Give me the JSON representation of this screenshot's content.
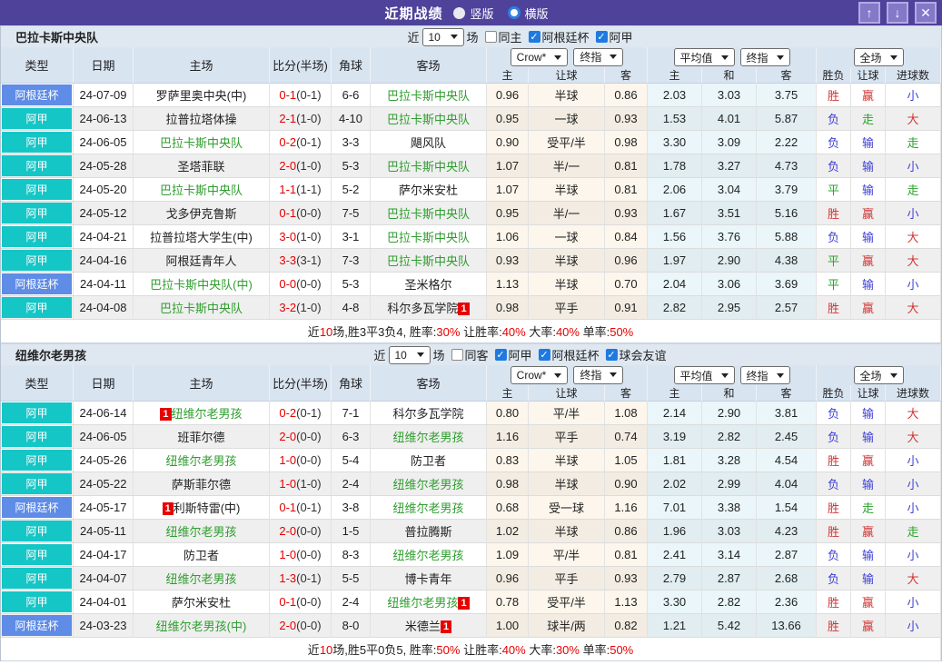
{
  "colors": {
    "titlebar_bg": "#4e429b",
    "cup_badge": "#5e8ce6",
    "league_badge": "#15c6c6",
    "focal_green": "#2f9e2f",
    "score_red": "#e60000",
    "win_red": "#d23535",
    "lose_blue": "#3e3ed6",
    "draw_green": "#2ba32b",
    "note_red": "#e60000",
    "checkbox_blue": "#1e7ae0"
  },
  "icons": {
    "check": "✓"
  },
  "titlebar": {
    "title": "近期战绩",
    "radios": [
      {
        "label": "竖版",
        "selected": true
      },
      {
        "label": "横版",
        "selected": false
      }
    ],
    "buttons": [
      {
        "name": "up",
        "glyph": "↑"
      },
      {
        "name": "down",
        "glyph": "↓"
      },
      {
        "name": "close",
        "glyph": "✕"
      }
    ]
  },
  "table_headers": {
    "left_cols": [
      "类型",
      "日期",
      "主场",
      "比分(半场)",
      "角球",
      "客场"
    ],
    "group1": [
      "Crow*",
      "终指"
    ],
    "group2": [
      "平均值",
      "终指"
    ],
    "group3": [
      "全场"
    ],
    "sub": [
      "主",
      "让球",
      "客",
      "主",
      "和",
      "客",
      "胜负",
      "让球",
      "进球数"
    ]
  },
  "sections": [
    {
      "team": "巴拉卡斯中央队",
      "filter": {
        "prefix": "近",
        "count": "10",
        "suffix": "场",
        "extra": {
          "label": "同主",
          "checked": false
        },
        "leagues": [
          {
            "label": "阿根廷杯",
            "checked": true
          },
          {
            "label": "阿甲",
            "checked": true
          }
        ]
      },
      "rows": [
        {
          "type": "阿根廷杯",
          "cup": true,
          "date": "24-07-09",
          "home": {
            "name": "罗萨里奥中央(中)",
            "focal": false
          },
          "score": "0-1",
          "half": "(0-1)",
          "corner": "6-6",
          "away": {
            "name": "巴拉卡斯中央队",
            "focal": true
          },
          "crow": [
            "0.96",
            "半球",
            "0.86"
          ],
          "avg": [
            "2.03",
            "3.03",
            "3.75"
          ],
          "res": [
            [
              "胜",
              "red"
            ],
            [
              "赢",
              "red"
            ],
            [
              "小",
              "blue"
            ]
          ]
        },
        {
          "type": "阿甲",
          "cup": false,
          "date": "24-06-13",
          "home": {
            "name": "拉普拉塔体操",
            "focal": false
          },
          "score": "2-1",
          "half": "(1-0)",
          "corner": "4-10",
          "away": {
            "name": "巴拉卡斯中央队",
            "focal": true
          },
          "crow": [
            "0.95",
            "一球",
            "0.93"
          ],
          "avg": [
            "1.53",
            "4.01",
            "5.87"
          ],
          "res": [
            [
              "负",
              "blue"
            ],
            [
              "走",
              "green"
            ],
            [
              "大",
              "red"
            ]
          ]
        },
        {
          "type": "阿甲",
          "cup": false,
          "date": "24-06-05",
          "home": {
            "name": "巴拉卡斯中央队",
            "focal": true
          },
          "score": "0-2",
          "half": "(0-1)",
          "corner": "3-3",
          "away": {
            "name": "飓风队",
            "focal": false
          },
          "crow": [
            "0.90",
            "受平/半",
            "0.98"
          ],
          "avg": [
            "3.30",
            "3.09",
            "2.22"
          ],
          "res": [
            [
              "负",
              "blue"
            ],
            [
              "输",
              "blue"
            ],
            [
              "走",
              "green"
            ]
          ]
        },
        {
          "type": "阿甲",
          "cup": false,
          "date": "24-05-28",
          "home": {
            "name": "圣塔菲联",
            "focal": false
          },
          "score": "2-0",
          "half": "(1-0)",
          "corner": "5-3",
          "away": {
            "name": "巴拉卡斯中央队",
            "focal": true
          },
          "crow": [
            "1.07",
            "半/一",
            "0.81"
          ],
          "avg": [
            "1.78",
            "3.27",
            "4.73"
          ],
          "res": [
            [
              "负",
              "blue"
            ],
            [
              "输",
              "blue"
            ],
            [
              "小",
              "blue"
            ]
          ]
        },
        {
          "type": "阿甲",
          "cup": false,
          "date": "24-05-20",
          "home": {
            "name": "巴拉卡斯中央队",
            "focal": true
          },
          "score": "1-1",
          "half": "(1-1)",
          "corner": "5-2",
          "away": {
            "name": "萨尔米安杜",
            "focal": false
          },
          "crow": [
            "1.07",
            "半球",
            "0.81"
          ],
          "avg": [
            "2.06",
            "3.04",
            "3.79"
          ],
          "res": [
            [
              "平",
              "green"
            ],
            [
              "输",
              "blue"
            ],
            [
              "走",
              "green"
            ]
          ]
        },
        {
          "type": "阿甲",
          "cup": false,
          "date": "24-05-12",
          "home": {
            "name": "戈多伊克鲁斯",
            "focal": false
          },
          "score": "0-1",
          "half": "(0-0)",
          "corner": "7-5",
          "away": {
            "name": "巴拉卡斯中央队",
            "focal": true
          },
          "crow": [
            "0.95",
            "半/一",
            "0.93"
          ],
          "avg": [
            "1.67",
            "3.51",
            "5.16"
          ],
          "res": [
            [
              "胜",
              "red"
            ],
            [
              "赢",
              "red"
            ],
            [
              "小",
              "blue"
            ]
          ]
        },
        {
          "type": "阿甲",
          "cup": false,
          "date": "24-04-21",
          "home": {
            "name": "拉普拉塔大学生(中)",
            "focal": false
          },
          "score": "3-0",
          "half": "(1-0)",
          "corner": "3-1",
          "away": {
            "name": "巴拉卡斯中央队",
            "focal": true
          },
          "crow": [
            "1.06",
            "一球",
            "0.84"
          ],
          "avg": [
            "1.56",
            "3.76",
            "5.88"
          ],
          "res": [
            [
              "负",
              "blue"
            ],
            [
              "输",
              "blue"
            ],
            [
              "大",
              "red"
            ]
          ]
        },
        {
          "type": "阿甲",
          "cup": false,
          "date": "24-04-16",
          "home": {
            "name": "阿根廷青年人",
            "focal": false
          },
          "score": "3-3",
          "half": "(3-1)",
          "corner": "7-3",
          "away": {
            "name": "巴拉卡斯中央队",
            "focal": true
          },
          "crow": [
            "0.93",
            "半球",
            "0.96"
          ],
          "avg": [
            "1.97",
            "2.90",
            "4.38"
          ],
          "res": [
            [
              "平",
              "green"
            ],
            [
              "赢",
              "red"
            ],
            [
              "大",
              "red"
            ]
          ]
        },
        {
          "type": "阿根廷杯",
          "cup": true,
          "date": "24-04-11",
          "home": {
            "name": "巴拉卡斯中央队(中)",
            "focal": true
          },
          "score": "0-0",
          "half": "(0-0)",
          "corner": "5-3",
          "away": {
            "name": "圣米格尔",
            "focal": false
          },
          "crow": [
            "1.13",
            "半球",
            "0.70"
          ],
          "avg": [
            "2.04",
            "3.06",
            "3.69"
          ],
          "res": [
            [
              "平",
              "green"
            ],
            [
              "输",
              "blue"
            ],
            [
              "小",
              "blue"
            ]
          ]
        },
        {
          "type": "阿甲",
          "cup": false,
          "date": "24-04-08",
          "home": {
            "name": "巴拉卡斯中央队",
            "focal": true
          },
          "score": "3-2",
          "half": "(1-0)",
          "corner": "4-8",
          "away": {
            "name": "科尔多瓦学院",
            "focal": false,
            "badge_after": "1"
          },
          "crow": [
            "0.98",
            "平手",
            "0.91"
          ],
          "avg": [
            "2.82",
            "2.95",
            "2.57"
          ],
          "res": [
            [
              "胜",
              "red"
            ],
            [
              "赢",
              "red"
            ],
            [
              "大",
              "red"
            ]
          ]
        }
      ],
      "summary": [
        {
          "t": "近",
          "c": "k"
        },
        {
          "t": "10",
          "c": "r"
        },
        {
          "t": "场,胜3平3负4, 胜率:",
          "c": "k"
        },
        {
          "t": "30%",
          "c": "r"
        },
        {
          "t": " 让胜率:",
          "c": "k"
        },
        {
          "t": "40%",
          "c": "r"
        },
        {
          "t": " 大率:",
          "c": "k"
        },
        {
          "t": "40%",
          "c": "r"
        },
        {
          "t": " 单率:",
          "c": "k"
        },
        {
          "t": "50%",
          "c": "r"
        }
      ]
    },
    {
      "team": "纽维尔老男孩",
      "filter": {
        "prefix": "近",
        "count": "10",
        "suffix": "场",
        "extra": {
          "label": "同客",
          "checked": false
        },
        "leagues": [
          {
            "label": "阿甲",
            "checked": true
          },
          {
            "label": "阿根廷杯",
            "checked": true
          },
          {
            "label": "球会友谊",
            "checked": true
          }
        ]
      },
      "rows": [
        {
          "type": "阿甲",
          "cup": false,
          "date": "24-06-14",
          "home": {
            "name": "纽维尔老男孩",
            "focal": true,
            "badge_before": "1"
          },
          "score": "0-2",
          "half": "(0-1)",
          "corner": "7-1",
          "away": {
            "name": "科尔多瓦学院",
            "focal": false
          },
          "crow": [
            "0.80",
            "平/半",
            "1.08"
          ],
          "avg": [
            "2.14",
            "2.90",
            "3.81"
          ],
          "res": [
            [
              "负",
              "blue"
            ],
            [
              "输",
              "blue"
            ],
            [
              "大",
              "red"
            ]
          ]
        },
        {
          "type": "阿甲",
          "cup": false,
          "date": "24-06-05",
          "home": {
            "name": "班菲尔德",
            "focal": false
          },
          "score": "2-0",
          "half": "(0-0)",
          "corner": "6-3",
          "away": {
            "name": "纽维尔老男孩",
            "focal": true
          },
          "crow": [
            "1.16",
            "平手",
            "0.74"
          ],
          "avg": [
            "3.19",
            "2.82",
            "2.45"
          ],
          "res": [
            [
              "负",
              "blue"
            ],
            [
              "输",
              "blue"
            ],
            [
              "大",
              "red"
            ]
          ]
        },
        {
          "type": "阿甲",
          "cup": false,
          "date": "24-05-26",
          "home": {
            "name": "纽维尔老男孩",
            "focal": true
          },
          "score": "1-0",
          "half": "(0-0)",
          "corner": "5-4",
          "away": {
            "name": "防卫者",
            "focal": false
          },
          "crow": [
            "0.83",
            "半球",
            "1.05"
          ],
          "avg": [
            "1.81",
            "3.28",
            "4.54"
          ],
          "res": [
            [
              "胜",
              "red"
            ],
            [
              "赢",
              "red"
            ],
            [
              "小",
              "blue"
            ]
          ]
        },
        {
          "type": "阿甲",
          "cup": false,
          "date": "24-05-22",
          "home": {
            "name": "萨斯菲尔德",
            "focal": false
          },
          "score": "1-0",
          "half": "(1-0)",
          "corner": "2-4",
          "away": {
            "name": "纽维尔老男孩",
            "focal": true
          },
          "crow": [
            "0.98",
            "半球",
            "0.90"
          ],
          "avg": [
            "2.02",
            "2.99",
            "4.04"
          ],
          "res": [
            [
              "负",
              "blue"
            ],
            [
              "输",
              "blue"
            ],
            [
              "小",
              "blue"
            ]
          ]
        },
        {
          "type": "阿根廷杯",
          "cup": true,
          "date": "24-05-17",
          "home": {
            "name": "利斯特雷(中)",
            "focal": false,
            "badge_before": "1"
          },
          "score": "0-1",
          "half": "(0-1)",
          "corner": "3-8",
          "away": {
            "name": "纽维尔老男孩",
            "focal": true
          },
          "crow": [
            "0.68",
            "受一球",
            "1.16"
          ],
          "avg": [
            "7.01",
            "3.38",
            "1.54"
          ],
          "res": [
            [
              "胜",
              "red"
            ],
            [
              "走",
              "green"
            ],
            [
              "小",
              "blue"
            ]
          ]
        },
        {
          "type": "阿甲",
          "cup": false,
          "date": "24-05-11",
          "home": {
            "name": "纽维尔老男孩",
            "focal": true
          },
          "score": "2-0",
          "half": "(0-0)",
          "corner": "1-5",
          "away": {
            "name": "普拉腾斯",
            "focal": false
          },
          "crow": [
            "1.02",
            "半球",
            "0.86"
          ],
          "avg": [
            "1.96",
            "3.03",
            "4.23"
          ],
          "res": [
            [
              "胜",
              "red"
            ],
            [
              "赢",
              "red"
            ],
            [
              "走",
              "green"
            ]
          ]
        },
        {
          "type": "阿甲",
          "cup": false,
          "date": "24-04-17",
          "home": {
            "name": "防卫者",
            "focal": false
          },
          "score": "1-0",
          "half": "(0-0)",
          "corner": "8-3",
          "away": {
            "name": "纽维尔老男孩",
            "focal": true
          },
          "crow": [
            "1.09",
            "平/半",
            "0.81"
          ],
          "avg": [
            "2.41",
            "3.14",
            "2.87"
          ],
          "res": [
            [
              "负",
              "blue"
            ],
            [
              "输",
              "blue"
            ],
            [
              "小",
              "blue"
            ]
          ]
        },
        {
          "type": "阿甲",
          "cup": false,
          "date": "24-04-07",
          "home": {
            "name": "纽维尔老男孩",
            "focal": true
          },
          "score": "1-3",
          "half": "(0-1)",
          "corner": "5-5",
          "away": {
            "name": "博卡青年",
            "focal": false
          },
          "crow": [
            "0.96",
            "平手",
            "0.93"
          ],
          "avg": [
            "2.79",
            "2.87",
            "2.68"
          ],
          "res": [
            [
              "负",
              "blue"
            ],
            [
              "输",
              "blue"
            ],
            [
              "大",
              "red"
            ]
          ]
        },
        {
          "type": "阿甲",
          "cup": false,
          "date": "24-04-01",
          "home": {
            "name": "萨尔米安杜",
            "focal": false
          },
          "score": "0-1",
          "half": "(0-0)",
          "corner": "2-4",
          "away": {
            "name": "纽维尔老男孩",
            "focal": true,
            "badge_after": "1"
          },
          "crow": [
            "0.78",
            "受平/半",
            "1.13"
          ],
          "avg": [
            "3.30",
            "2.82",
            "2.36"
          ],
          "res": [
            [
              "胜",
              "red"
            ],
            [
              "赢",
              "red"
            ],
            [
              "小",
              "blue"
            ]
          ]
        },
        {
          "type": "阿根廷杯",
          "cup": true,
          "date": "24-03-23",
          "home": {
            "name": "纽维尔老男孩(中)",
            "focal": true
          },
          "score": "2-0",
          "half": "(0-0)",
          "corner": "8-0",
          "away": {
            "name": "米德兰",
            "focal": false,
            "badge_after": "1"
          },
          "crow": [
            "1.00",
            "球半/两",
            "0.82"
          ],
          "avg": [
            "1.21",
            "5.42",
            "13.66"
          ],
          "res": [
            [
              "胜",
              "red"
            ],
            [
              "赢",
              "red"
            ],
            [
              "小",
              "blue"
            ]
          ]
        }
      ],
      "summary": [
        {
          "t": "近",
          "c": "k"
        },
        {
          "t": "10",
          "c": "r"
        },
        {
          "t": "场,胜5平0负5, 胜率:",
          "c": "k"
        },
        {
          "t": "50%",
          "c": "r"
        },
        {
          "t": " 让胜率:",
          "c": "k"
        },
        {
          "t": "40%",
          "c": "r"
        },
        {
          "t": " 大率:",
          "c": "k"
        },
        {
          "t": "30%",
          "c": "r"
        },
        {
          "t": " 单率:",
          "c": "k"
        },
        {
          "t": "50%",
          "c": "r"
        }
      ]
    }
  ]
}
